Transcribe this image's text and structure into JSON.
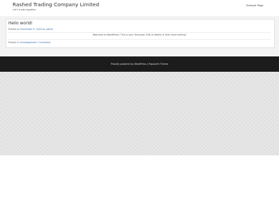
{
  "header": {
    "site_title": "Rashed Trading Company Limited",
    "site_description": "Let's trade together",
    "nav": [
      {
        "label": "Sample Page"
      }
    ]
  },
  "post": {
    "title": "Hello world!",
    "meta": {
      "posted_on_prefix": "Posted on",
      "date": "December 9, 2020",
      "by_text": "by",
      "author": "admin"
    },
    "body": "Welcome to WordPress. This is your first post. Edit or delete it, then start writing!",
    "footer": {
      "posted_in_prefix": "Posted in",
      "category": "Uncategorized",
      "comments": "1 Comment"
    }
  },
  "site_footer": {
    "credit": "Proudly powered by WordPress | Popularfx Theme"
  }
}
